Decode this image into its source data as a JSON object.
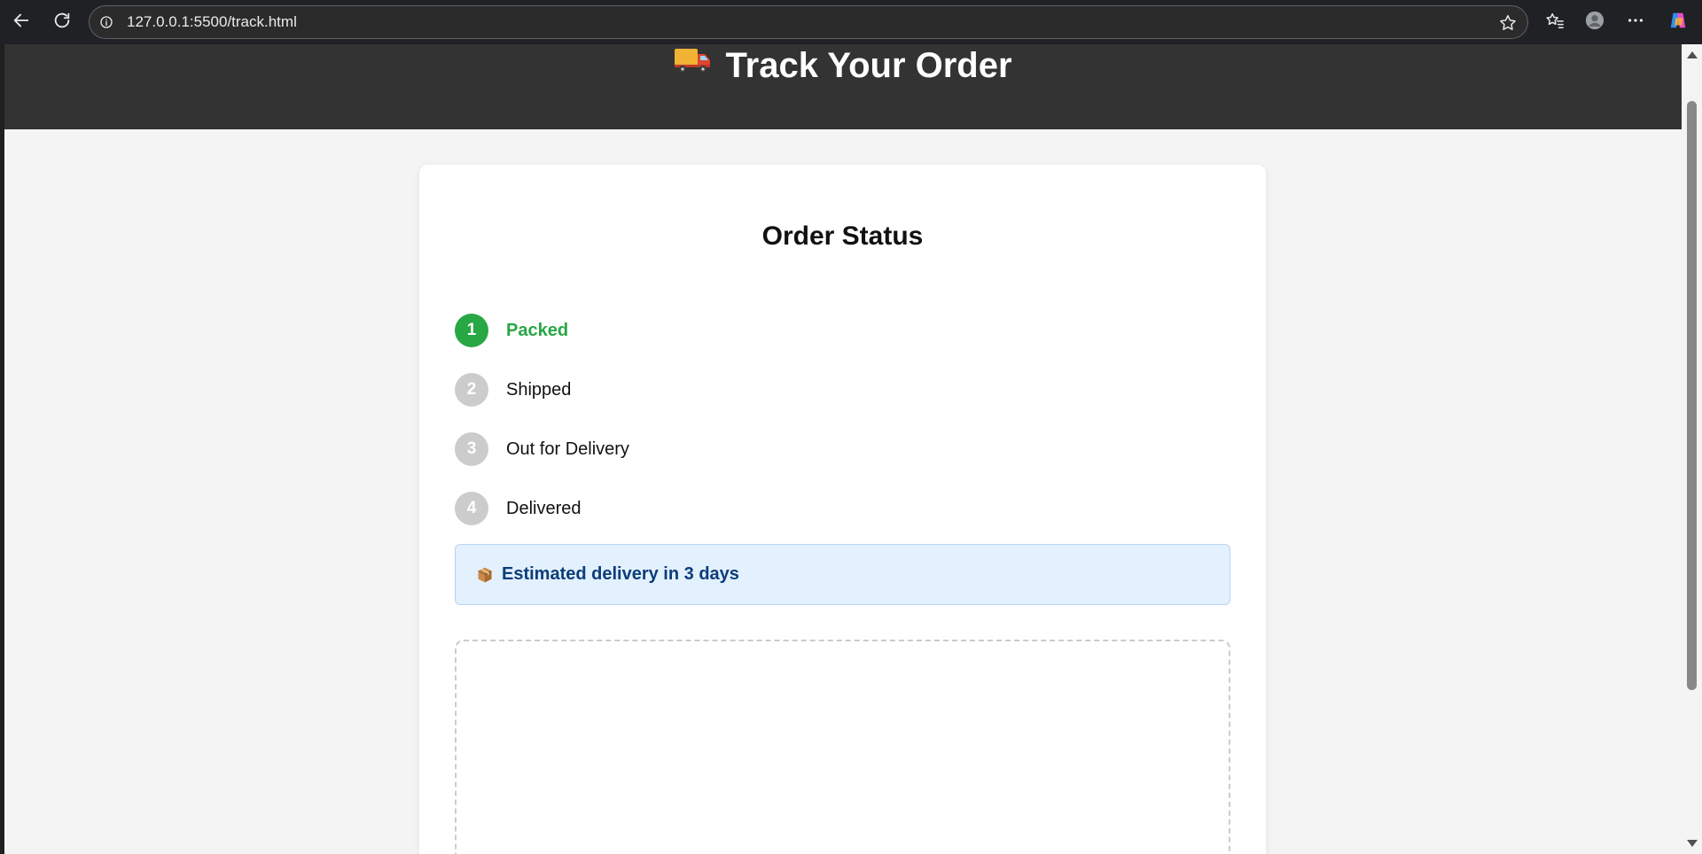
{
  "browser": {
    "url": "127.0.0.1:5500/track.html",
    "icons": [
      "back-arrow-icon",
      "reload-icon",
      "info-icon",
      "favorite-star-icon",
      "favorites-list-icon",
      "profile-icon",
      "more-options-icon",
      "copilot-icon"
    ]
  },
  "header": {
    "title": "Track Your Order",
    "icon": "delivery-truck-icon",
    "background": "#333333"
  },
  "card": {
    "title": "Order Status",
    "steps": [
      {
        "number": "1",
        "label": "Packed",
        "active": true
      },
      {
        "number": "2",
        "label": "Shipped",
        "active": false
      },
      {
        "number": "3",
        "label": "Out for Delivery",
        "active": false
      },
      {
        "number": "4",
        "label": "Delivered",
        "active": false
      }
    ],
    "estimate": {
      "icon": "package-icon",
      "text": "Estimated delivery in 3 days"
    }
  },
  "colors": {
    "active_step": "#28a745",
    "inactive_step": "#cccccc",
    "estimate_text": "#0b3d7a",
    "estimate_bg": "#e3f0fd"
  }
}
